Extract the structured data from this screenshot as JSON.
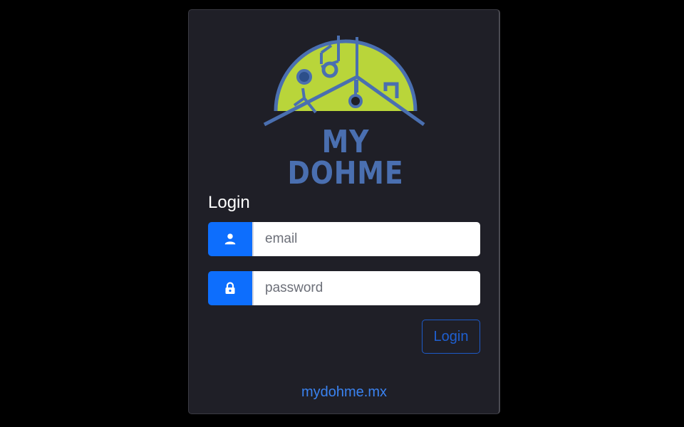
{
  "brand": {
    "name": "MY DOHME",
    "colors": {
      "green": "#b9d53a",
      "blue": "#4a6fb0"
    }
  },
  "form": {
    "title": "Login",
    "email": {
      "placeholder": "email",
      "value": "",
      "icon": "user-icon"
    },
    "password": {
      "placeholder": "password",
      "value": "",
      "icon": "lock-icon"
    },
    "submit_label": "Login"
  },
  "footer": {
    "link_text": "mydohme.mx"
  },
  "colors": {
    "page_background": "#000000",
    "card_background": "#1f1f27",
    "accent": "#0d6efd",
    "link": "#3a82f0"
  }
}
